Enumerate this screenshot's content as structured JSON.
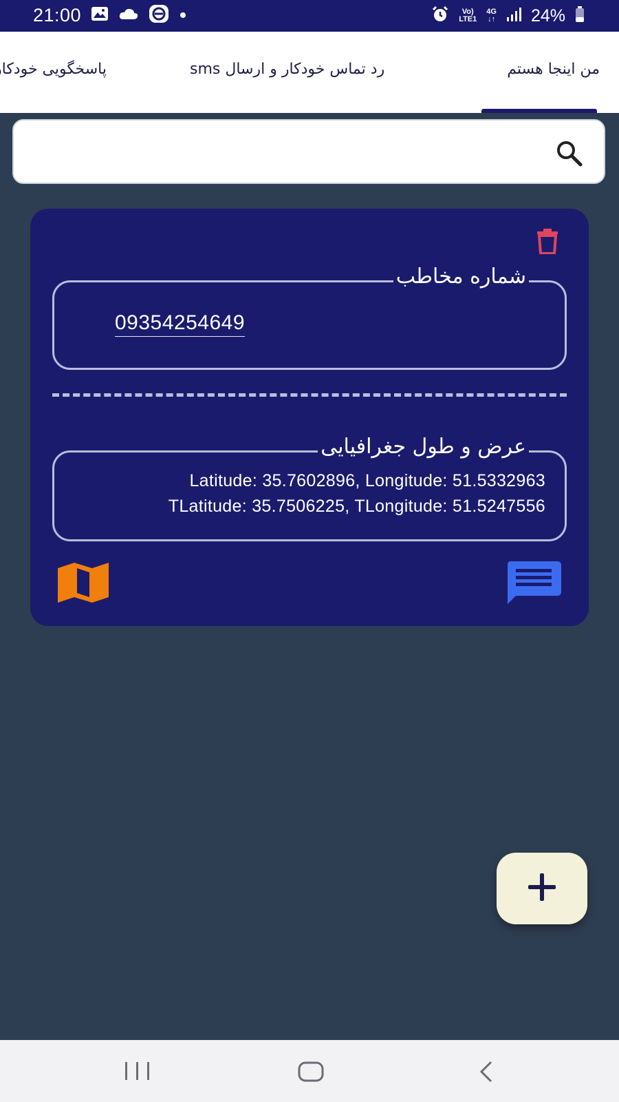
{
  "status_bar": {
    "time": "21:00",
    "battery": "24%",
    "net_top": "Vo)",
    "net_bottom": "LTE1",
    "net_type": "4G",
    "icons_left": [
      "image-icon",
      "cloud-icon",
      "browser-icon",
      "dot-icon"
    ],
    "icons_right": [
      "alarm-icon",
      "volte-icon",
      "4g-icon",
      "signal-icon",
      "battery-icon"
    ]
  },
  "tabs": [
    {
      "label": "من اینجا هستم",
      "selected": true
    },
    {
      "label": "رد تماس خودکار و ارسال sms",
      "selected": false
    },
    {
      "label": "پاسخگویی خودکار",
      "selected": false
    }
  ],
  "search": {
    "placeholder": ""
  },
  "card": {
    "phone_label": "شماره مخاطب",
    "phone_value": "09354254649",
    "geo_label": "عرض و طول جغرافیایی",
    "geo_line_1": "Latitude: 35.7602896, Longitude: 51.5332963",
    "geo_line_2": "TLatitude: 35.7506225, TLongitude: 51.5247556"
  },
  "fab": {
    "label": "+"
  },
  "colors": {
    "status_bar": "#1a1a6e",
    "background": "#2e3e52",
    "card": "#1b1b6e",
    "delete": "#e0455e",
    "map": "#f07f0c",
    "message": "#3b6cf0",
    "fab": "#f3f1d9"
  }
}
